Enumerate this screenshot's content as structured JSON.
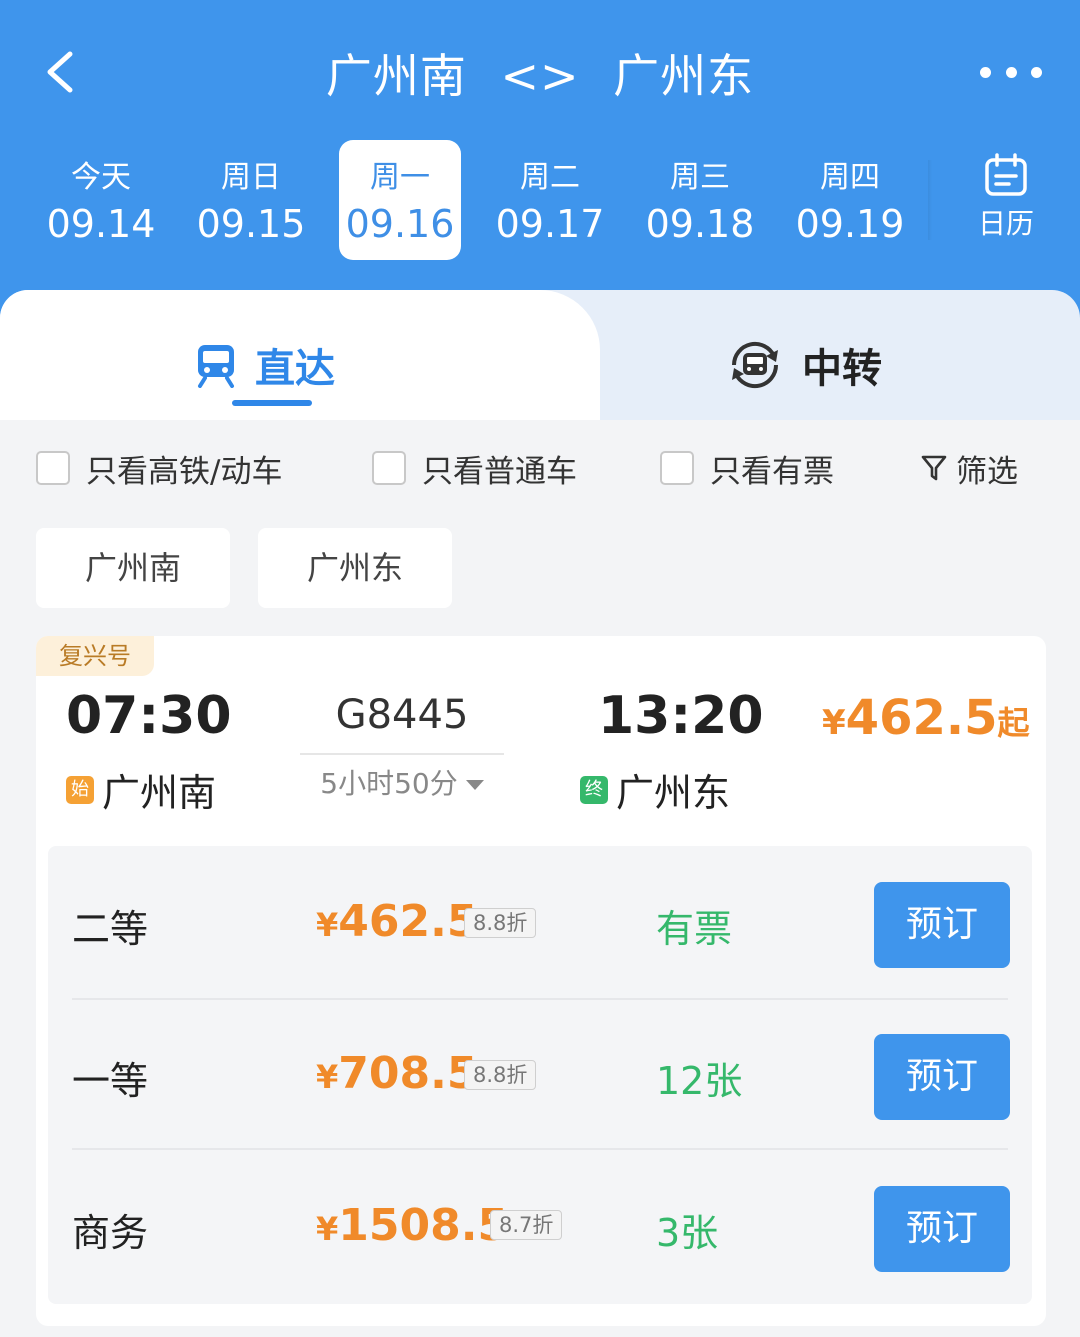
{
  "header": {
    "title_from": "广州南",
    "title_sep": "<>",
    "title_to": "广州东",
    "calendar_label": "日历"
  },
  "dates": [
    {
      "label": "今天",
      "date": "09.14",
      "selected": false
    },
    {
      "label": "周日",
      "date": "09.15",
      "selected": false
    },
    {
      "label": "周一",
      "date": "09.16",
      "selected": true
    },
    {
      "label": "周二",
      "date": "09.17",
      "selected": false
    },
    {
      "label": "周三",
      "date": "09.18",
      "selected": false
    },
    {
      "label": "周四",
      "date": "09.19",
      "selected": false
    }
  ],
  "tabs": {
    "direct": "直达",
    "transfer": "中转"
  },
  "filters": {
    "high_speed": "只看高铁/动车",
    "regular": "只看普通车",
    "available": "只看有票",
    "filter_btn": "筛选"
  },
  "stations": [
    "广州南",
    "广州东"
  ],
  "train": {
    "badge": "复兴号",
    "dep_time": "07:30",
    "arr_time": "13:20",
    "number": "G8445",
    "duration": "5小时50分",
    "dep_tag": "始",
    "dep_station": "广州南",
    "arr_tag": "终",
    "arr_station": "广州东",
    "price_currency": "¥",
    "min_price": "462.5",
    "price_suffix": "起",
    "seats": [
      {
        "name": "二等",
        "currency": "¥",
        "price": "462.5",
        "discount": "8.8折",
        "availability": "有票",
        "book": "预订"
      },
      {
        "name": "一等",
        "currency": "¥",
        "price": "708.5",
        "discount": "8.8折",
        "availability": "12张",
        "book": "预订"
      },
      {
        "name": "商务",
        "currency": "¥",
        "price": "1508.5",
        "discount": "8.7折",
        "availability": "3张",
        "book": "预订"
      }
    ]
  },
  "colors": {
    "brand_blue": "#3f95ec",
    "price_orange": "#f08a2a",
    "available_green": "#35b86b",
    "badge_bg": "#fdf0da"
  },
  "icons": {
    "back": "chevron-left-icon",
    "more": "more-dots-icon",
    "calendar": "calendar-icon",
    "direct": "train-icon",
    "transfer": "transfer-train-icon",
    "filter": "funnel-icon"
  }
}
